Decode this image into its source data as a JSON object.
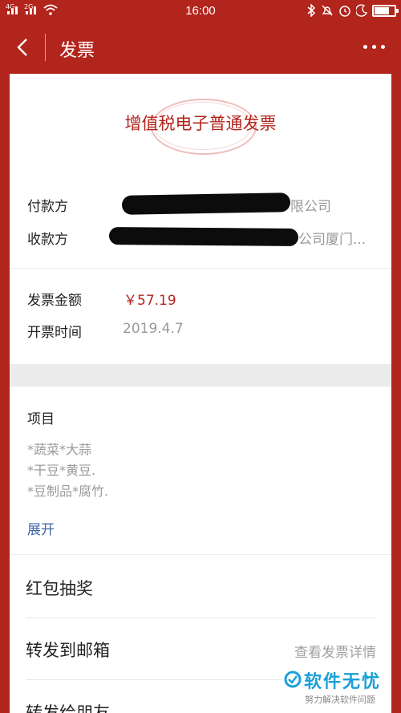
{
  "status": {
    "time": "16:00",
    "signal1": "4G",
    "signal2": "2G"
  },
  "nav": {
    "title": "发票"
  },
  "invoice": {
    "title": "增值税电子普通发票",
    "payer_label": "付款方",
    "payer_value": "限公司",
    "payee_label": "收款方",
    "payee_value": "公司厦门...",
    "amount_label": "发票金额",
    "amount_value": "￥57.19",
    "date_label": "开票时间",
    "date_value": "2019.4.7"
  },
  "items": {
    "heading": "项目",
    "lines": [
      "*蔬菜*大蒜",
      "*干豆*黄豆.",
      "*豆制品*腐竹."
    ],
    "expand": "展开"
  },
  "menu": {
    "lottery": "红包抽奖",
    "email": "转发到邮箱",
    "details": "查看发票详情",
    "friend": "转发给朋友"
  },
  "watermark": {
    "name": "软件无忧",
    "slogan": "努力解决软件问题"
  },
  "colors": {
    "brand_red": "#b2251c",
    "link_blue": "#3f64a8"
  }
}
